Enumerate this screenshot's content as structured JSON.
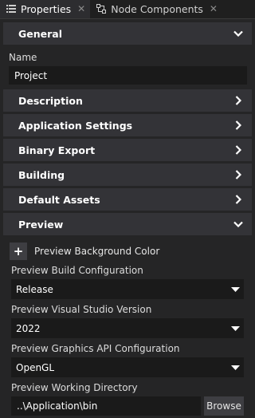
{
  "tabs": [
    {
      "label": "Properties",
      "icon": "list-icon",
      "active": true
    },
    {
      "label": "Node Components",
      "icon": "nodes-icon",
      "active": false
    }
  ],
  "sections": {
    "general": {
      "label": "General",
      "expanded": true
    },
    "description": {
      "label": "Description"
    },
    "application_settings": {
      "label": "Application Settings"
    },
    "binary_export": {
      "label": "Binary Export"
    },
    "building": {
      "label": "Building"
    },
    "default_assets": {
      "label": "Default Assets"
    },
    "preview": {
      "label": "Preview",
      "expanded": true
    }
  },
  "general": {
    "name_label": "Name",
    "name_value": "Project"
  },
  "preview": {
    "bg_color_label": "Preview Background Color",
    "build_config_label": "Preview Build Configuration",
    "build_config_value": "Release",
    "vs_version_label": "Preview Visual Studio Version",
    "vs_version_value": "2022",
    "graphics_api_label": "Preview Graphics API Configuration",
    "graphics_api_value": "OpenGL",
    "working_dir_label": "Preview Working Directory",
    "working_dir_value": "..\\Application\\bin",
    "browse_label": "Browse"
  },
  "colors": {
    "panel_bg": "#252526",
    "section_bg": "#333337",
    "input_bg": "#1a1a1a",
    "button_bg": "#3e3e42"
  }
}
